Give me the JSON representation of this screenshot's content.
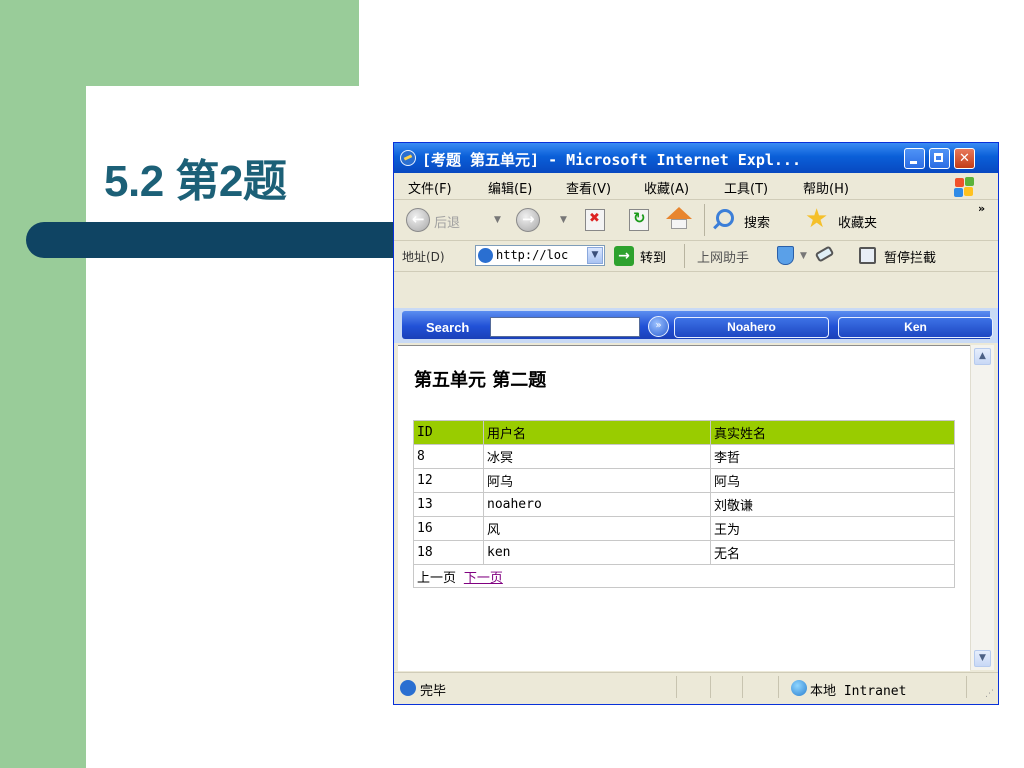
{
  "slide": {
    "title": "5.2  第2题"
  },
  "window": {
    "title": "[考题 第五单元] - Microsoft Internet Expl..."
  },
  "menubar": {
    "items": [
      "文件(F)",
      "编辑(E)",
      "查看(V)",
      "收藏(A)",
      "工具(T)",
      "帮助(H)"
    ]
  },
  "toolbar": {
    "back_label": "后退",
    "search_label": "搜索",
    "favorites_label": "收藏夹"
  },
  "addressbar": {
    "label": "地址(D)",
    "url": "http://loc",
    "go_label": "转到",
    "helper_label": "上网助手",
    "popup_block_label": "暂停拦截"
  },
  "searchbar": {
    "label": "Search",
    "query": "",
    "pill_1": "Noahero",
    "pill_2": "Ken"
  },
  "page": {
    "heading": "第五单元 第二题",
    "table": {
      "headers": [
        "ID",
        "用户名",
        "真实姓名"
      ],
      "rows": [
        [
          "8",
          "冰冥",
          "李哲"
        ],
        [
          "12",
          "阿乌",
          "阿乌"
        ],
        [
          "13",
          "noahero",
          "刘敬谦"
        ],
        [
          "16",
          "风",
          "王为"
        ],
        [
          "18",
          "ken",
          "无名"
        ]
      ]
    },
    "pager": {
      "prev": "上一页",
      "next": "下一页"
    }
  },
  "statusbar": {
    "text": "完毕",
    "zone": "本地 Intranet"
  },
  "colors": {
    "slide_green": "#99cc99",
    "slide_blue_bar": "#0f4463",
    "title_teal": "#1c6077",
    "table_header": "#99cc00",
    "xp_titlebar": "#0a5fd8"
  }
}
